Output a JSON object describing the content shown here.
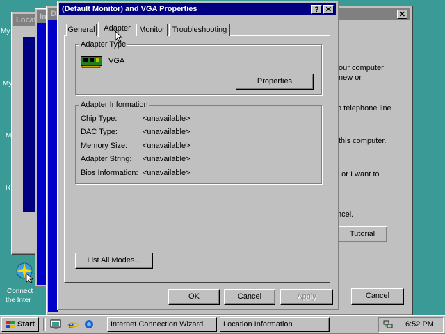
{
  "desktop": {
    "labels": [
      "My",
      "My",
      "M",
      "R"
    ],
    "icon_label_1": "Connect",
    "icon_label_2": "the Inter",
    "colors": {
      "desktop": "#3a9a96",
      "title_active": "#000080",
      "title_inactive": "#808080"
    }
  },
  "back_windows": {
    "location_title": "Locati",
    "in_title": "In",
    "di_title": "Di"
  },
  "wizard": {
    "text_lines": [
      "our computer",
      "new or",
      "o telephone line",
      "this computer.",
      ", or I want to",
      "ncel."
    ],
    "tutorial_label": "Tutorial",
    "cancel_label": "Cancel"
  },
  "dialog": {
    "title": "(Default Monitor) and VGA Properties",
    "help_label": "?",
    "close_label": "✕",
    "tabs": [
      "General",
      "Adapter",
      "Monitor",
      "Troubleshooting"
    ],
    "active_tab": "Adapter",
    "adapter_type": {
      "group_label": "Adapter Type",
      "name": "VGA",
      "properties_label": "Properties"
    },
    "adapter_info": {
      "group_label": "Adapter Information",
      "rows": [
        {
          "label": "Chip Type:",
          "value": "<unavailable>"
        },
        {
          "label": "DAC Type:",
          "value": "<unavailable>"
        },
        {
          "label": "Memory Size:",
          "value": "<unavailable>"
        },
        {
          "label": "Adapter String:",
          "value": "<unavailable>"
        },
        {
          "label": "Bios Information:",
          "value": "<unavailable>"
        }
      ]
    },
    "list_all_modes_label": "List All Modes...",
    "ok_label": "OK",
    "cancel_label": "Cancel",
    "apply_label": "Apply"
  },
  "taskbar": {
    "start_label": "Start",
    "tasks": [
      "Internet Connection Wizard",
      "Location Information"
    ],
    "time": "6:52 PM"
  }
}
